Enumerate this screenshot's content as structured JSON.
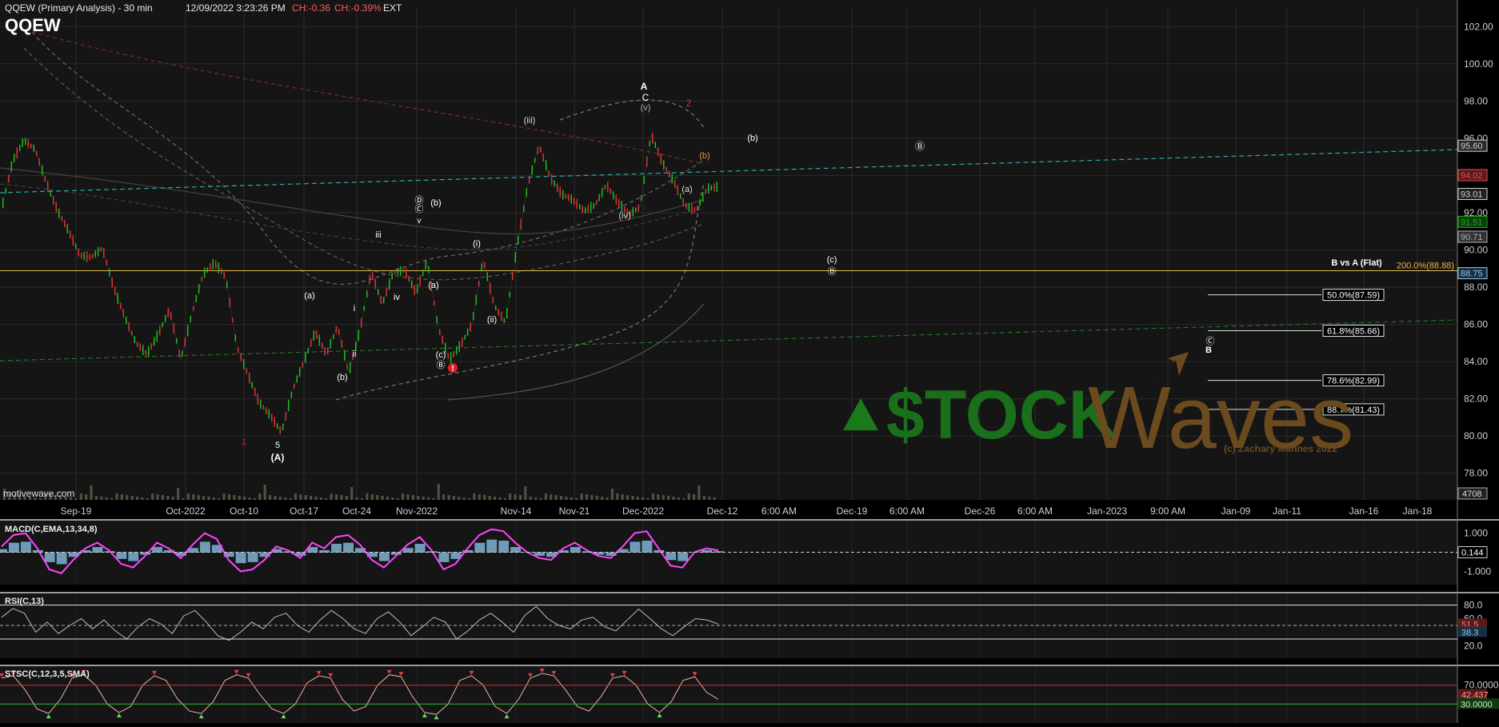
{
  "header": {
    "title": "QQEW (Primary Analysis) - 30 min",
    "timestamp": "12/09/2022 3:23:26 PM",
    "change_abs": "CH:-0.36",
    "change_pct": "CH:-0.39%",
    "session": "EXT",
    "symbol": "QQEW"
  },
  "footer": {
    "source": "motivewave.com"
  },
  "watermark": {
    "brand_left": "$TOCK",
    "brand_right": "Waves",
    "copyright": "(c) Zachary Mannes 2022"
  },
  "colors": {
    "up": "#19c219",
    "down": "#e03030",
    "fib": "#e8b84a",
    "trend": "#2aa8a8",
    "macd": "#ff44ff",
    "hist": "#8ec8f0"
  },
  "chart_data": [
    {
      "type": "line",
      "title": "QQEW (Primary Analysis) - 30 min",
      "x_ticks": [
        "Sep-19",
        "Oct-2022",
        "Oct-10",
        "Oct-17",
        "Oct-24",
        "Nov-2022",
        "Nov-14",
        "Nov-21",
        "Dec-2022",
        "Dec-12",
        "6:00 AM",
        "Dec-19",
        "6:00 AM",
        "Dec-26",
        "6:00 AM",
        "Jan-2023",
        "9:00 AM",
        "Jan-09",
        "Jan-11",
        "Jan-16",
        "Jan-18"
      ],
      "ylim": [
        77,
        103
      ],
      "y_ticks": [
        78,
        80,
        82,
        84,
        86,
        88,
        90,
        92,
        94,
        96,
        98,
        100,
        102
      ],
      "y_tick_labels": [
        "78.00",
        "80.00",
        "82.00",
        "84.00",
        "86.00",
        "88.00",
        "90.00",
        "92.00",
        "94.00",
        "96.00",
        "98.00",
        "100.00",
        "102.00"
      ],
      "series": [
        {
          "values": [
            92.2,
            94.8,
            95.9,
            95.4,
            93.6,
            92.1,
            91.0,
            89.7,
            89.6,
            90.1,
            88.0,
            86.4,
            85.0,
            84.4,
            85.5,
            86.8,
            84.1,
            86.6,
            88.7,
            89.3,
            88.6,
            84.8,
            83.3,
            81.8,
            81.1,
            80.2,
            82.5,
            84.0,
            85.6,
            84.4,
            85.9,
            83.4,
            85.7,
            88.8,
            87.1,
            88.8,
            88.9,
            87.7,
            89.4,
            85.8,
            84.1,
            84.9,
            86.0,
            89.5,
            87.0,
            86.1,
            90.1,
            93.5,
            95.6,
            93.9,
            93.0,
            92.7,
            92.1,
            92.4,
            93.5,
            92.6,
            91.9,
            92.3,
            96.2,
            94.7,
            93.7,
            92.4,
            92.1,
            93.3,
            93.4
          ]
        }
      ],
      "price_labels": [
        "95.60",
        "94.02",
        "93.01",
        "91.51",
        "90.71",
        "88.75",
        "4708"
      ],
      "price_label_values": [
        95.6,
        94.02,
        93.01,
        91.51,
        90.71,
        88.75
      ],
      "fib_level": {
        "label": "200.0%(88.88)",
        "value": 88.88
      },
      "fib_title": "B vs A (Flat)",
      "fib_targets": [
        {
          "label": "50.0%(87.59)",
          "value": 87.59
        },
        {
          "label": "61.8%(85.66)",
          "value": 85.66
        },
        {
          "label": "78.6%(82.99)",
          "value": 82.99
        },
        {
          "label": "88.7%(81.43)",
          "value": 81.43
        }
      ],
      "wave_labels": [
        "A",
        "C",
        "(v)",
        "(iii)",
        "(iv)",
        "(a)",
        "(b)",
        "(b)",
        "Ⓑ",
        "(c)",
        "Ⓓ",
        "(b)",
        "Ⓓ",
        "Ⓒ",
        "v",
        "iii",
        "iv",
        "(a)",
        "i",
        "ii",
        "(b)",
        "(i)",
        "(ii)",
        "(a)",
        "(c)",
        "Ⓑ",
        "1",
        "5",
        "(A)",
        "Ⓒ",
        "B",
        "2"
      ]
    },
    {
      "type": "line",
      "title": "MACD(C,EMA,13,34,8)",
      "ylim": [
        -1.4,
        1.4
      ],
      "y_tick_labels": [
        "1.000",
        "-1.000"
      ],
      "last_value_label": "0.144",
      "series": [
        {
          "values": [
            0.3,
            0.9,
            1.0,
            0.2,
            -0.9,
            -1.1,
            -0.4,
            0.2,
            0.5,
            0.1,
            -0.6,
            -0.8,
            -0.2,
            0.5,
            0.2,
            -0.3,
            0.4,
            1.0,
            0.7,
            -0.4,
            -1.0,
            -0.9,
            -0.4,
            0.3,
            0.1,
            -0.3,
            0.5,
            0.2,
            0.8,
            0.9,
            0.4,
            -0.4,
            -0.8,
            -0.2,
            0.4,
            0.8,
            0.1,
            -0.9,
            -0.6,
            0.2,
            0.9,
            1.2,
            1.1,
            0.5,
            0.0,
            -0.3,
            -0.4,
            0.2,
            0.5,
            0.1,
            -0.2,
            -0.3,
            0.3,
            1.0,
            1.1,
            0.2,
            -0.7,
            -0.8,
            0.0,
            0.2,
            0.1
          ]
        }
      ]
    },
    {
      "type": "line",
      "title": "RSI(C,13)",
      "ylim": [
        10,
        90
      ],
      "y_tick_labels": [
        "80.0",
        "60.0",
        "20.0"
      ],
      "last_value_labels": [
        "51.5",
        "38.3"
      ],
      "series": [
        {
          "values": [
            62,
            75,
            68,
            40,
            55,
            38,
            50,
            60,
            45,
            58,
            42,
            30,
            48,
            60,
            52,
            38,
            64,
            72,
            55,
            35,
            28,
            40,
            55,
            45,
            62,
            68,
            50,
            40,
            58,
            72,
            60,
            45,
            38,
            60,
            70,
            55,
            35,
            48,
            62,
            55,
            30,
            42,
            58,
            68,
            55,
            40,
            65,
            78,
            60,
            50,
            45,
            58,
            62,
            48,
            42,
            58,
            74,
            60,
            45,
            35,
            48,
            60,
            58,
            52
          ]
        }
      ]
    },
    {
      "type": "line",
      "title": "STSC(C,12,3,5,SMA)",
      "ylim": [
        0,
        100
      ],
      "y_tick_labels": [
        "70.0000",
        "30.0000"
      ],
      "last_value_labels": [
        "42.437",
        "30.0000"
      ],
      "series": [
        {
          "values": [
            85,
            90,
            60,
            20,
            10,
            40,
            85,
            92,
            70,
            30,
            12,
            25,
            70,
            90,
            80,
            40,
            15,
            10,
            35,
            80,
            92,
            85,
            50,
            20,
            10,
            30,
            75,
            90,
            85,
            40,
            15,
            25,
            70,
            92,
            88,
            45,
            12,
            8,
            30,
            80,
            90,
            70,
            25,
            10,
            40,
            85,
            95,
            90,
            60,
            25,
            15,
            45,
            85,
            90,
            70,
            30,
            12,
            35,
            80,
            88,
            55,
            40
          ]
        }
      ]
    }
  ]
}
